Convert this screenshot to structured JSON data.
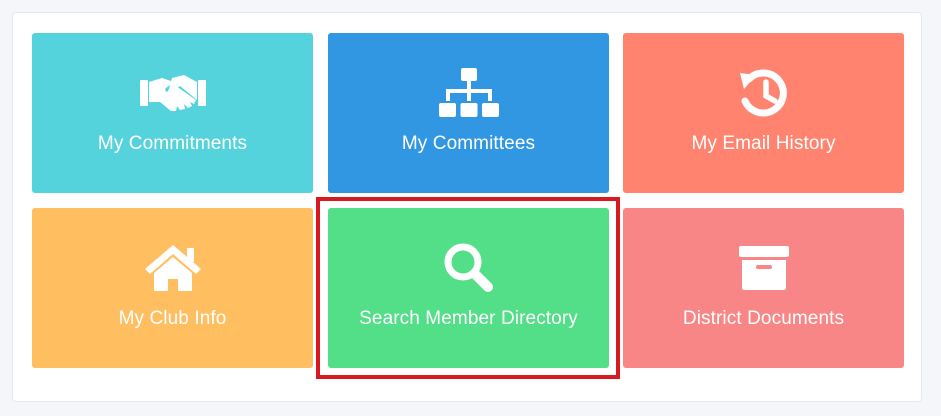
{
  "tiles": [
    {
      "label": "My Commitments",
      "color": "#54d3dc",
      "icon": "handshake-icon"
    },
    {
      "label": "My Committees",
      "color": "#3197e2",
      "icon": "org-chart-icon"
    },
    {
      "label": "My Email History",
      "color": "#ff836f",
      "icon": "history-icon"
    },
    {
      "label": "My Club Info",
      "color": "#ffbf60",
      "icon": "home-icon"
    },
    {
      "label": "Search Member Directory",
      "color": "#53de88",
      "icon": "search-icon"
    },
    {
      "label": "District Documents",
      "color": "#f98686",
      "icon": "archive-box-icon"
    }
  ],
  "highlight": {
    "target": "Search Member Directory",
    "color": "#d71920"
  }
}
